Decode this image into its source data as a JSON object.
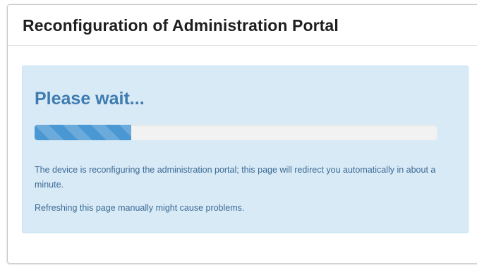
{
  "panel": {
    "title": "Reconfiguration of Administration Portal"
  },
  "alert": {
    "heading": "Please wait...",
    "progress_fraction": 0.24,
    "message": "The device is reconfiguring the administration portal; this page will redirect you automatically in about a minute.",
    "warning": "Refreshing this page manually might cause problems."
  },
  "colors": {
    "alert_background": "#d9eaf7",
    "heading": "#3e7bb0",
    "progress_fill": "#4a98d3",
    "progress_track": "#f2f2f2"
  }
}
